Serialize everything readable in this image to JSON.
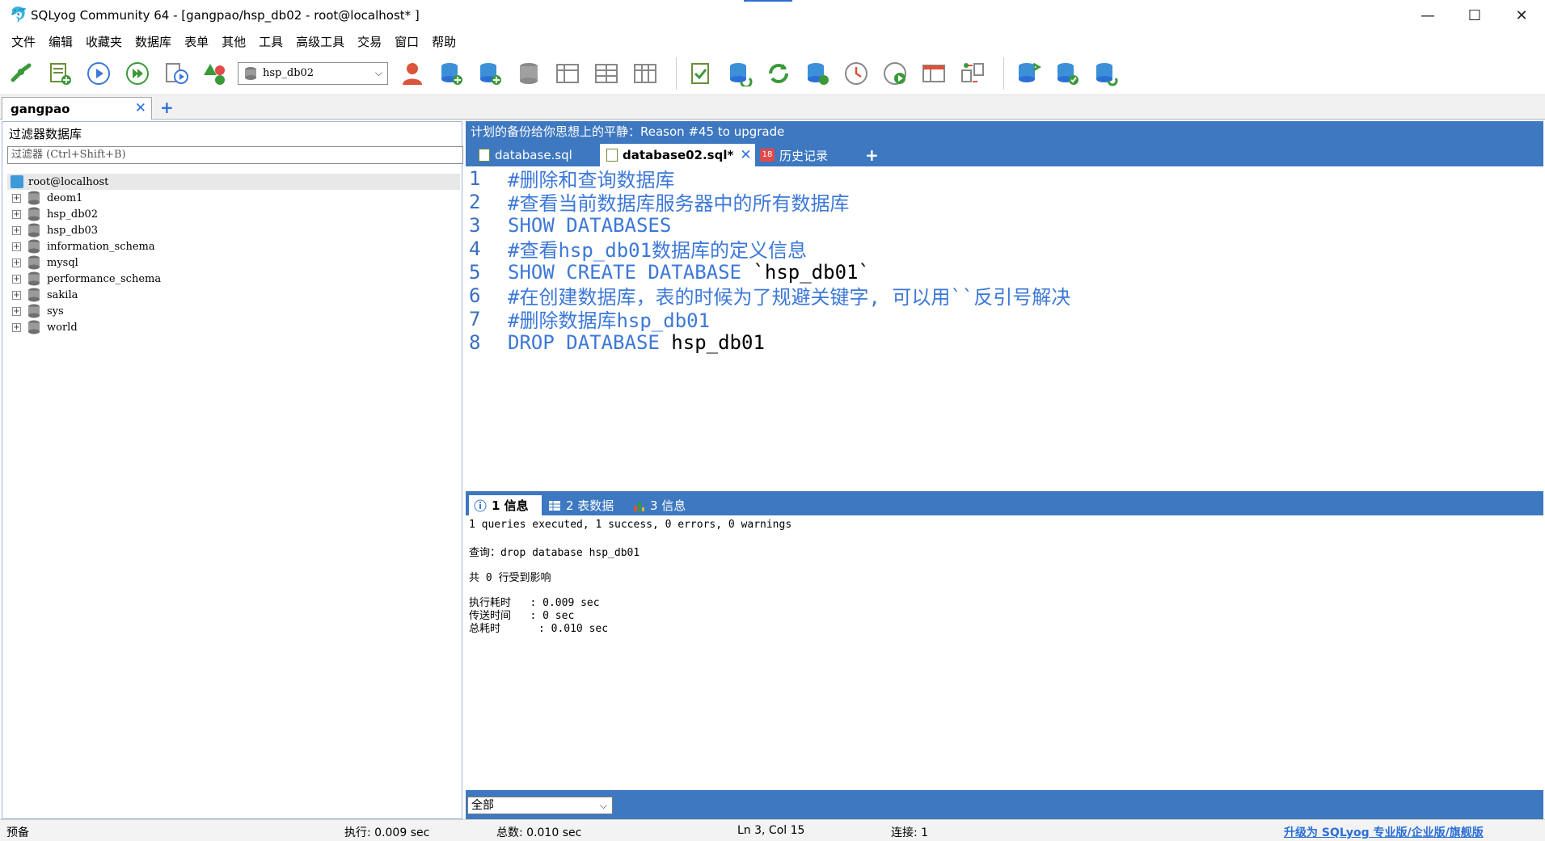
{
  "window": {
    "title": "SQLyog Community 64 - [gangpao/hsp_db02 - root@localhost* ]",
    "controls": {
      "minimize": "—",
      "maximize": "☐",
      "close": "✕"
    }
  },
  "menu": [
    "文件",
    "编辑",
    "收藏夹",
    "数据库",
    "表单",
    "其他",
    "工具",
    "高级工具",
    "交易",
    "窗口",
    "帮助"
  ],
  "toolbar": {
    "db_select": "hsp_db02"
  },
  "connection_tab": {
    "label": "gangpao",
    "close": "✕",
    "add": "+"
  },
  "left_panel": {
    "filter_title": "过滤器数据库",
    "filter_placeholder": "过滤器 (Ctrl+Shift+B)",
    "root": "root@localhost",
    "databases": [
      "deom1",
      "hsp_db02",
      "hsp_db03",
      "information_schema",
      "mysql",
      "performance_schema",
      "sakila",
      "sys",
      "world"
    ]
  },
  "right_panel": {
    "upgrade_bar": "计划的备份给你思想上的平静：Reason #45 to upgrade",
    "tabs": [
      {
        "label": "database.sql"
      },
      {
        "label": "database02.sql*",
        "close": "✕"
      },
      {
        "label": "历史记录"
      }
    ],
    "tab_add": "+"
  },
  "editor": {
    "lines": [
      {
        "no": "1",
        "text": "#删除和查询数据库"
      },
      {
        "no": "2",
        "text": "#查看当前数据库服务器中的所有数据库"
      },
      {
        "no": "3",
        "text": "SHOW DATABASES"
      },
      {
        "no": "4",
        "text": "#查看hsp_db01数据库的定义信息"
      },
      {
        "no": "5",
        "kw": "SHOW CREATE DATABASE",
        "rest": " `hsp_db01`"
      },
      {
        "no": "6",
        "text": "#在创建数据库，表的时候为了规避关键字, 可以用``反引号解决"
      },
      {
        "no": "7",
        "text": "#删除数据库hsp_db01"
      },
      {
        "no": "8",
        "kw": "DROP DATABASE",
        "rest": " hsp_db01"
      }
    ]
  },
  "result_tabs": [
    {
      "label": "1 信息"
    },
    {
      "label": "2 表数据"
    },
    {
      "label": "3 信息"
    }
  ],
  "results": {
    "summary": "1 queries executed, 1 success, 0 errors, 0 warnings",
    "query": "查询：drop database hsp_db01",
    "affected": "共 0 行受到影响",
    "exec_time": "执行耗时   : 0.009 sec",
    "transfer_time": "传送时间   : 0 sec",
    "total_time": "总耗时      : 0.010 sec"
  },
  "result_filter": "全部",
  "status": {
    "ready": "预备",
    "exec": "执行: 0.009 sec",
    "total": "总数: 0.010 sec",
    "position": "Ln 3, Col 15",
    "connections": "连接: 1",
    "upgrade": "升级为 SQLyog 专业版/企业版/旗舰版"
  },
  "colors": {
    "accent": "#3d78c0",
    "keyword": "#3c78d8",
    "link": "#2b6fd6"
  },
  "icons": [
    "new-connection-icon",
    "new-query-icon",
    "execute-icon",
    "execute-all-icon",
    "execute-step-icon",
    "schema-icon",
    "user-manager-icon",
    "create-db-icon",
    "add-table-icon",
    "db-icon",
    "table-grid-icon",
    "table-grid-icon",
    "table-grid-icon",
    "query-builder-icon",
    "sync-icon",
    "refresh-icon",
    "db-add-icon",
    "history-icon",
    "play-circle-icon",
    "schema-designer-icon",
    "compare-icon",
    "backup-icon",
    "restore-icon",
    "sync-db-icon"
  ]
}
